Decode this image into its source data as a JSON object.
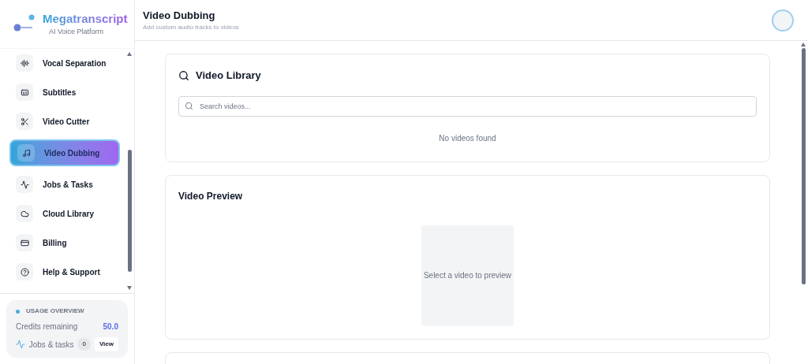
{
  "brand": {
    "name": "Megatranscript",
    "tagline": "AI Voice Platform"
  },
  "nav": [
    {
      "label": "Vocal Separation",
      "selected": false
    },
    {
      "label": "Subtitles",
      "selected": false
    },
    {
      "label": "Video Cutter",
      "selected": false
    },
    {
      "label": "Video Dubbing",
      "selected": true
    },
    {
      "label": "Jobs & Tasks",
      "selected": false
    },
    {
      "label": "Cloud Library",
      "selected": false
    },
    {
      "label": "Billing",
      "selected": false
    },
    {
      "label": "Help & Support",
      "selected": false
    }
  ],
  "usage": {
    "title": "USAGE OVERVIEW",
    "credits_label": "Credits remaining",
    "credits": "50.0",
    "jobs_label": "Jobs & tasks",
    "jobs_count": "0",
    "view_button": "View"
  },
  "header": {
    "title": "Video Dubbing",
    "subtitle": "Add custom audio tracks to videos"
  },
  "library": {
    "title": "Video Library",
    "search": {
      "placeholder": "Search videos..."
    },
    "empty": "No videos found"
  },
  "preview": {
    "title": "Video Preview",
    "placeholder": "Select a video to preview"
  }
}
